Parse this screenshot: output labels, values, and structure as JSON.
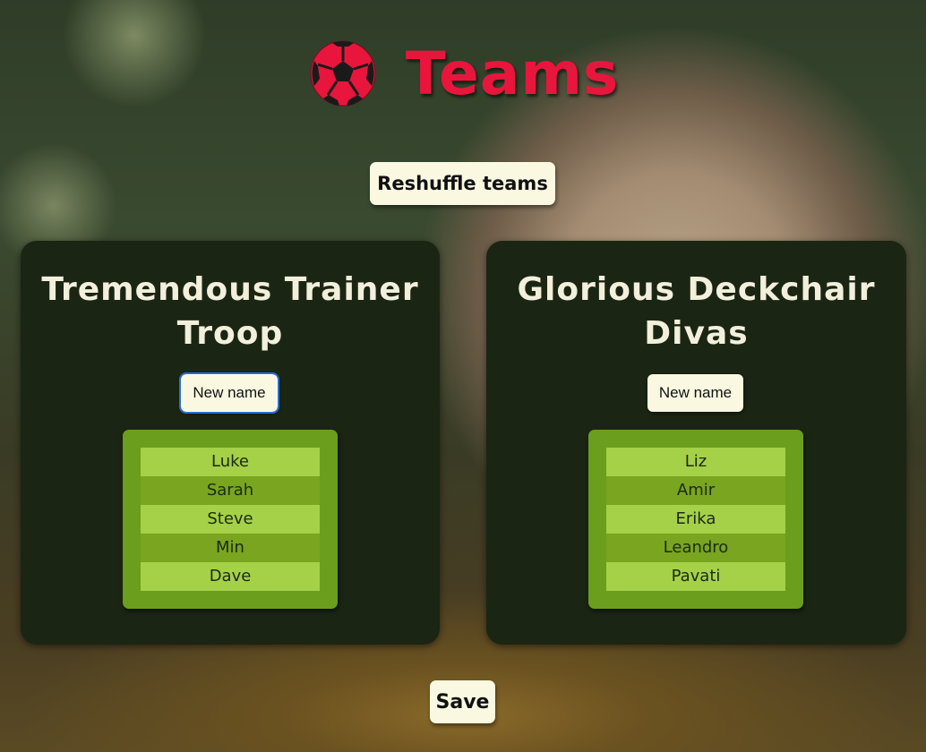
{
  "app": {
    "title": "Teams",
    "logo_icon": "soccer-ball-icon",
    "accent_color": "#e8163c"
  },
  "toolbar": {
    "reshuffle_label": "Reshuffle teams",
    "save_label": "Save"
  },
  "teams": [
    {
      "name": "Tremendous Trainer Troop",
      "new_name_label": "New name",
      "players": [
        "Luke",
        "Sarah",
        "Steve",
        "Min",
        "Dave"
      ]
    },
    {
      "name": "Glorious Deckchair Divas",
      "new_name_label": "New name",
      "players": [
        "Liz",
        "Amir",
        "Erika",
        "Leandro",
        "Pavati"
      ]
    }
  ],
  "colors": {
    "card_bg": "#1b2513",
    "button_bg": "#fbf8e1",
    "player_odd": "#a4d148",
    "player_even": "#79a520"
  }
}
